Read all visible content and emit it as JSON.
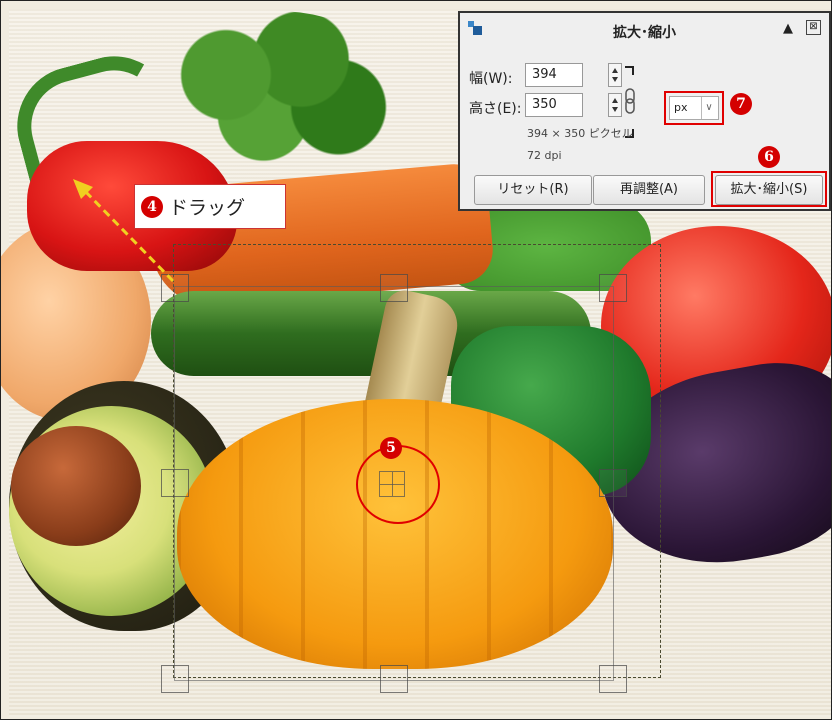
{
  "annotations": {
    "drag_label": "ドラッグ",
    "marker4": "4",
    "marker5": "5",
    "marker6": "6",
    "marker7": "7"
  },
  "dialog": {
    "title": "拡大･縮小",
    "up_icon": "▲",
    "close_icon": "⊠",
    "width_label": "幅(W):",
    "width_value": "394",
    "height_label": "高さ(E):",
    "height_value": "350",
    "size_info": "394 × 350 ピクセル",
    "dpi_info": "72 dpi",
    "unit_value": "px",
    "chevron": "∨",
    "reset_button": "リセット(R)",
    "readjust_button": "再調整(A)",
    "scale_button": "拡大･縮小(S)"
  },
  "colors": {
    "accent_red": "#e00000",
    "arrow_yellow": "#f0d020"
  }
}
